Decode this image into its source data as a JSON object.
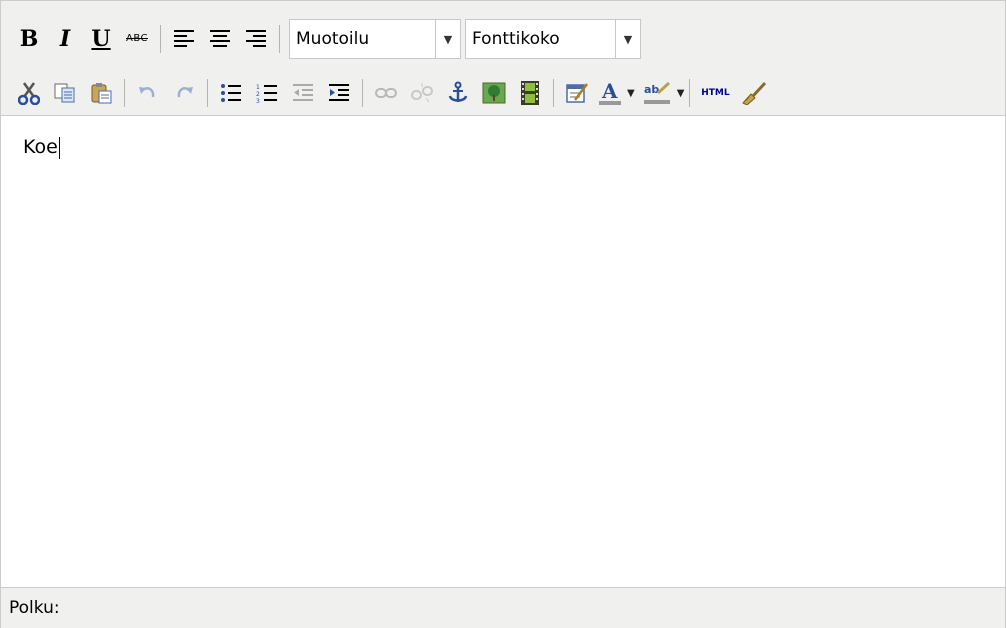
{
  "toolbar": {
    "row1": {
      "bold_label": "B",
      "italic_label": "I",
      "underline_label": "U",
      "strikethrough_label": "ABC",
      "format_select": "Muotoilu",
      "fontsize_select": "Fonttikoko"
    },
    "row2": {
      "html_label": "HTML",
      "icons": [
        "cut-icon",
        "copy-icon",
        "paste-icon",
        "undo-icon",
        "redo-icon",
        "bullet-list-icon",
        "numbered-list-icon",
        "outdent-icon",
        "indent-icon",
        "link-icon",
        "unlink-icon",
        "anchor-icon",
        "image-icon",
        "media-icon",
        "cleanup-icon",
        "text-color-icon",
        "highlight-color-icon",
        "html-source-icon",
        "remove-format-icon"
      ]
    }
  },
  "content": {
    "text": "Koe"
  },
  "status": {
    "path_label": "Polku:"
  },
  "colors": {
    "toolbar_bg": "#f0f0ee",
    "border": "#cccccc",
    "icon_blue": "#4a6ea8",
    "text_color_red": "#cc0000"
  }
}
